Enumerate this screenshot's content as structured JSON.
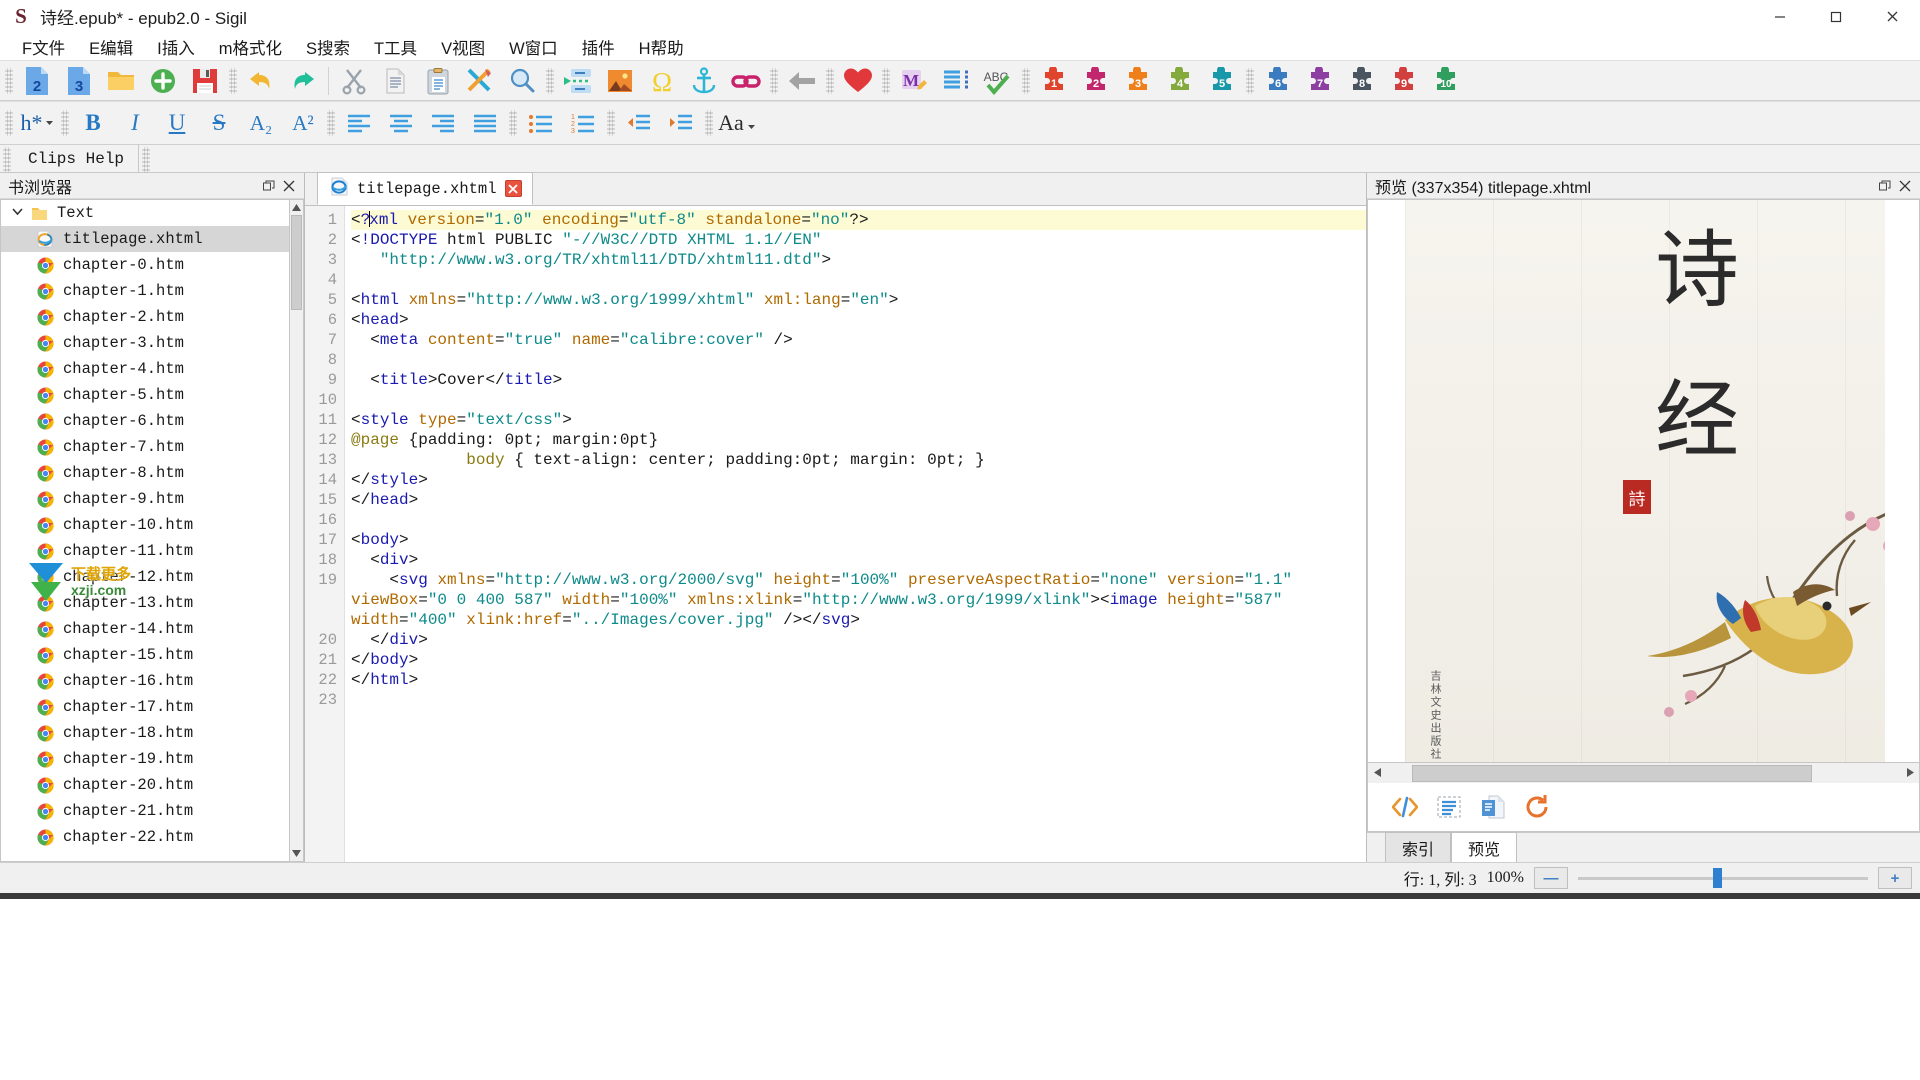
{
  "window": {
    "logo": "S",
    "title": "诗经.epub* - epub2.0 - Sigil",
    "minimize": "—",
    "maximize": "❐",
    "close": "✕"
  },
  "menubar": {
    "items": [
      {
        "label": "F文件",
        "name": "menu-file"
      },
      {
        "label": "E编辑",
        "name": "menu-edit"
      },
      {
        "label": "I插入",
        "name": "menu-insert"
      },
      {
        "label": "m格式化",
        "name": "menu-format"
      },
      {
        "label": "S搜索",
        "name": "menu-search"
      },
      {
        "label": "T工具",
        "name": "menu-tools"
      },
      {
        "label": "V视图",
        "name": "menu-view"
      },
      {
        "label": "W窗口",
        "name": "menu-window"
      },
      {
        "label": "插件",
        "name": "menu-plugins"
      },
      {
        "label": "H帮助",
        "name": "menu-help"
      }
    ]
  },
  "toolbar_main": {
    "icons": [
      "new-epub2-icon",
      "new-epub3-icon",
      "open-folder-icon",
      "add-file-icon",
      "save-icon",
      "undo-icon",
      "redo-icon",
      "cut-icon",
      "copy-icon",
      "paste-icon",
      "clean-source-icon",
      "zoom-search-icon",
      "split-marker-icon",
      "insert-image-icon",
      "insert-special-char-icon",
      "insert-id-icon",
      "insert-link-icon",
      "back-icon",
      "heart-icon",
      "metadata-editor-icon",
      "generate-toc-icon",
      "spellcheck-icon",
      "plugin-1-icon",
      "plugin-2-icon",
      "plugin-3-icon",
      "plugin-4-icon",
      "plugin-5-icon",
      "plugin-6-icon",
      "plugin-7-icon",
      "plugin-8-icon",
      "plugin-9-icon",
      "plugin-10-icon"
    ],
    "plugin_labels": [
      "1",
      "2",
      "3",
      "4",
      "5",
      "6",
      "7",
      "8",
      "9",
      "10"
    ],
    "spellcheck_label": "ABC",
    "metadata_label": "M"
  },
  "toolbar_format": {
    "heading_label": "h*",
    "bold_label": "B",
    "italic_label": "I",
    "underline_label": "U",
    "strike_label": "S",
    "subscript_label": "A₂",
    "superscript_label": "A²",
    "casing_label": "Aa",
    "icons": [
      "heading-select-icon",
      "bold-icon",
      "italic-icon",
      "underline-icon",
      "strikethrough-icon",
      "subscript-icon",
      "superscript-icon",
      "align-left-icon",
      "align-center-icon",
      "align-right-icon",
      "align-justify-icon",
      "bullet-list-icon",
      "numbered-list-icon",
      "decrease-indent-icon",
      "increase-indent-icon",
      "change-case-icon",
      "chevron-down-icon"
    ]
  },
  "clipsbar": {
    "tab_label": "Clips Help"
  },
  "book_browser": {
    "title": "书浏览器",
    "float_icon": "restore-icon",
    "close_icon": "close-icon",
    "root": {
      "label": "Text",
      "icon": "folder-icon",
      "twisty": "chevron-down-icon"
    },
    "files": [
      {
        "label": "titlepage.xhtml",
        "icon": "ie-html-icon",
        "selected": true
      },
      {
        "label": "chapter-0.htm",
        "icon": "chrome-html-icon",
        "selected": false
      },
      {
        "label": "chapter-1.htm",
        "icon": "chrome-html-icon",
        "selected": false
      },
      {
        "label": "chapter-2.htm",
        "icon": "chrome-html-icon",
        "selected": false
      },
      {
        "label": "chapter-3.htm",
        "icon": "chrome-html-icon",
        "selected": false
      },
      {
        "label": "chapter-4.htm",
        "icon": "chrome-html-icon",
        "selected": false
      },
      {
        "label": "chapter-5.htm",
        "icon": "chrome-html-icon",
        "selected": false
      },
      {
        "label": "chapter-6.htm",
        "icon": "chrome-html-icon",
        "selected": false
      },
      {
        "label": "chapter-7.htm",
        "icon": "chrome-html-icon",
        "selected": false
      },
      {
        "label": "chapter-8.htm",
        "icon": "chrome-html-icon",
        "selected": false
      },
      {
        "label": "chapter-9.htm",
        "icon": "chrome-html-icon",
        "selected": false
      },
      {
        "label": "chapter-10.htm",
        "icon": "chrome-html-icon",
        "selected": false
      },
      {
        "label": "chapter-11.htm",
        "icon": "chrome-html-icon",
        "selected": false
      },
      {
        "label": "chapter-12.htm",
        "icon": "chrome-html-icon",
        "selected": false
      },
      {
        "label": "chapter-13.htm",
        "icon": "chrome-html-icon",
        "selected": false
      },
      {
        "label": "chapter-14.htm",
        "icon": "chrome-html-icon",
        "selected": false
      },
      {
        "label": "chapter-15.htm",
        "icon": "chrome-html-icon",
        "selected": false
      },
      {
        "label": "chapter-16.htm",
        "icon": "chrome-html-icon",
        "selected": false
      },
      {
        "label": "chapter-17.htm",
        "icon": "chrome-html-icon",
        "selected": false
      },
      {
        "label": "chapter-18.htm",
        "icon": "chrome-html-icon",
        "selected": false
      },
      {
        "label": "chapter-19.htm",
        "icon": "chrome-html-icon",
        "selected": false
      },
      {
        "label": "chapter-20.htm",
        "icon": "chrome-html-icon",
        "selected": false
      },
      {
        "label": "chapter-21.htm",
        "icon": "chrome-html-icon",
        "selected": false
      },
      {
        "label": "chapter-22.htm",
        "icon": "chrome-html-icon",
        "selected": false
      }
    ],
    "watermark": {
      "line1": "下载更多",
      "line2": "xzji.com"
    }
  },
  "editor": {
    "tab": {
      "label": "titlepage.xhtml",
      "icon": "ie-html-icon",
      "close": "✕"
    },
    "line_numbers": [
      "1",
      "2",
      "3",
      "4",
      "5",
      "6",
      "7",
      "8",
      "9",
      "10",
      "11",
      "12",
      "13",
      "14",
      "15",
      "16",
      "17",
      "18",
      "19",
      "20",
      "21",
      "22",
      "23"
    ],
    "code_lines": [
      "<?xml version=\"1.0\" encoding=\"utf-8\" standalone=\"no\"?>",
      "<!DOCTYPE html PUBLIC \"-//W3C//DTD XHTML 1.1//EN\"",
      "   \"http://www.w3.org/TR/xhtml11/DTD/xhtml11.dtd\">",
      "",
      "<html xmlns=\"http://www.w3.org/1999/xhtml\" xml:lang=\"en\">",
      "<head>",
      "  <meta content=\"true\" name=\"calibre:cover\" />",
      "",
      "  <title>Cover</title>",
      "",
      "<style type=\"text/css\">",
      "@page {padding: 0pt; margin:0pt}",
      "            body { text-align: center; padding:0pt; margin: 0pt; }",
      "</style>",
      "</head>",
      "",
      "<body>",
      "  <div>",
      "    <svg xmlns=\"http://www.w3.org/2000/svg\" height=\"100%\" preserveAspectRatio=\"none\" version=\"1.1\" viewBox=\"0 0 400 587\" width=\"100%\" xmlns:xlink=\"http://www.w3.org/1999/xlink\"><image height=\"587\" width=\"400\" xlink:href=\"../Images/cover.jpg\" /></svg>",
      "  </div>",
      "</body>",
      "</html>",
      ""
    ]
  },
  "preview": {
    "title": "预览 (337x354) titlepage.xhtml",
    "float_icon": "restore-icon",
    "close_icon": "close-icon",
    "cover": {
      "char_top": "诗",
      "char_bottom": "经",
      "seal": "詩",
      "publisher": "吉林文史出版社"
    },
    "tools": [
      "view-source-icon",
      "inspect-icon",
      "copy-page-icon",
      "reload-icon"
    ],
    "tabs": [
      {
        "label": "索引",
        "active": false
      },
      {
        "label": "预览",
        "active": true
      }
    ]
  },
  "statusbar": {
    "position": "行: 1, 列: 3",
    "zoom": "100%",
    "zoom_out": "—",
    "zoom_in": "+"
  },
  "colors": {
    "accent": "#2f7fd0",
    "close_red": "#e81123",
    "tab_close_red": "#e8523f",
    "highlight_line": "#fdfbd4",
    "selection_gray": "#d6d6d6",
    "string_teal": "#0e8a8a",
    "attr_brown": "#b06a00",
    "tag_blue": "#1a1ab0"
  }
}
